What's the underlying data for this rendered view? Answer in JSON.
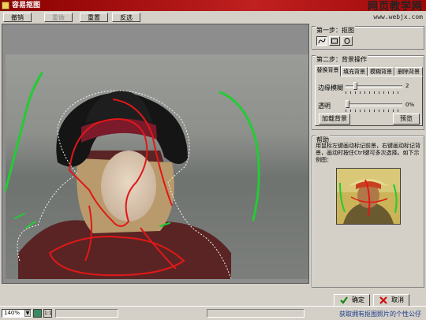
{
  "window": {
    "title": "容易抠图"
  },
  "watermark": {
    "line1": "网页教学网",
    "line2": "www.webjx.com"
  },
  "toolbar": {
    "undo": "撤销",
    "redo": "重做",
    "reset": "重置",
    "invert": "反选"
  },
  "step1": {
    "title": "第一步：抠图",
    "tools": [
      "freehand-tool",
      "rectangle-tool",
      "ellipse-tool"
    ]
  },
  "step2": {
    "title": "第二步：背景操作",
    "tabs": [
      "替换背景",
      "填充背景",
      "模糊背景",
      "删除背景"
    ],
    "active_tab": "替换背景",
    "edge_blur": {
      "label": "边缘模糊",
      "value": "2",
      "level": 0.15
    },
    "transparency": {
      "label": "透明",
      "value": "0%",
      "level": 0.0
    },
    "load_bg": "加载背景",
    "preview": "预览"
  },
  "help": {
    "title": "帮助",
    "text": "用鼠标左键画动标记前景，右键画动标记背景，画动时按住Ctrl键可多次选择。如下示例图："
  },
  "actions": {
    "ok": "确定",
    "cancel": "取消"
  },
  "status": {
    "zoom": "140%",
    "fit_label": "1:1",
    "footer_note": "获取拥有抠图照片的个性公仔"
  },
  "colors": {
    "foreground_mark": "#e01818",
    "background_mark": "#22cc33",
    "title_bar": "#a01010"
  }
}
